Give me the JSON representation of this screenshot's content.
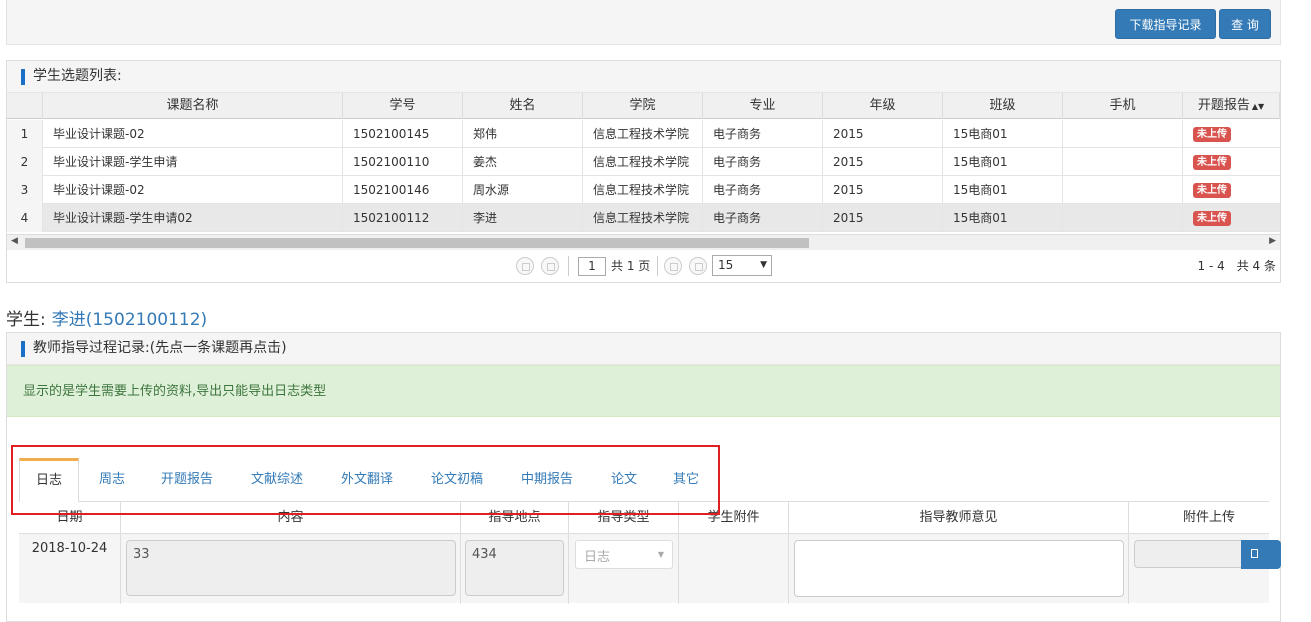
{
  "toolbar": {
    "download_label": "下载指导记录",
    "query_label": "查 询"
  },
  "topic_panel": {
    "title": "学生选题列表:",
    "columns": [
      "课题名称",
      "学号",
      "姓名",
      "学院",
      "专业",
      "年级",
      "班级",
      "手机",
      "开题报告"
    ],
    "rows": [
      {
        "no": "1",
        "topic": "毕业设计课题-02",
        "id": "1502100145",
        "name": "郑伟",
        "college": "信息工程技术学院",
        "major": "电子商务",
        "grade": "2015",
        "class": "15电商01",
        "phone": "",
        "report": "未上传"
      },
      {
        "no": "2",
        "topic": "毕业设计课题-学生申请",
        "id": "1502100110",
        "name": "姜杰",
        "college": "信息工程技术学院",
        "major": "电子商务",
        "grade": "2015",
        "class": "15电商01",
        "phone": "",
        "report": "未上传"
      },
      {
        "no": "3",
        "topic": "毕业设计课题-02",
        "id": "1502100146",
        "name": "周水源",
        "college": "信息工程技术学院",
        "major": "电子商务",
        "grade": "2015",
        "class": "15电商01",
        "phone": "",
        "report": "未上传"
      },
      {
        "no": "4",
        "topic": "毕业设计课题-学生申请02",
        "id": "1502100112",
        "name": "李进",
        "college": "信息工程技术学院",
        "major": "电子商务",
        "grade": "2015",
        "class": "15电商01",
        "phone": "",
        "report": "未上传"
      }
    ],
    "selected_row": 4,
    "pager": {
      "page": "1",
      "total_pages_text": "共 1 页",
      "page_size": "15",
      "summary": "1 - 4　共 4 条"
    }
  },
  "student": {
    "label": "学生:",
    "value": "李进(1502100112)"
  },
  "guide_panel": {
    "title": "教师指导过程记录:(先点一条课题再点击)",
    "notice": "显示的是学生需要上传的资料,导出只能导出日志类型",
    "tabs": [
      "日志",
      "周志",
      "开题报告",
      "文献综述",
      "外文翻译",
      "论文初稿",
      "中期报告",
      "论文",
      "其它"
    ],
    "active_tab": "日志",
    "table": {
      "headers": [
        "日期",
        "内容",
        "指导地点",
        "指导类型",
        "学生附件",
        "指导教师意见",
        "附件上传"
      ],
      "row": {
        "date": "2018-10-24",
        "content": "33",
        "place": "434",
        "type": "日志"
      }
    }
  },
  "colors": {
    "primary": "#337ab7",
    "danger": "#d9534f",
    "alert_green": "#dff0d8",
    "highlight_box": "#e02020"
  }
}
